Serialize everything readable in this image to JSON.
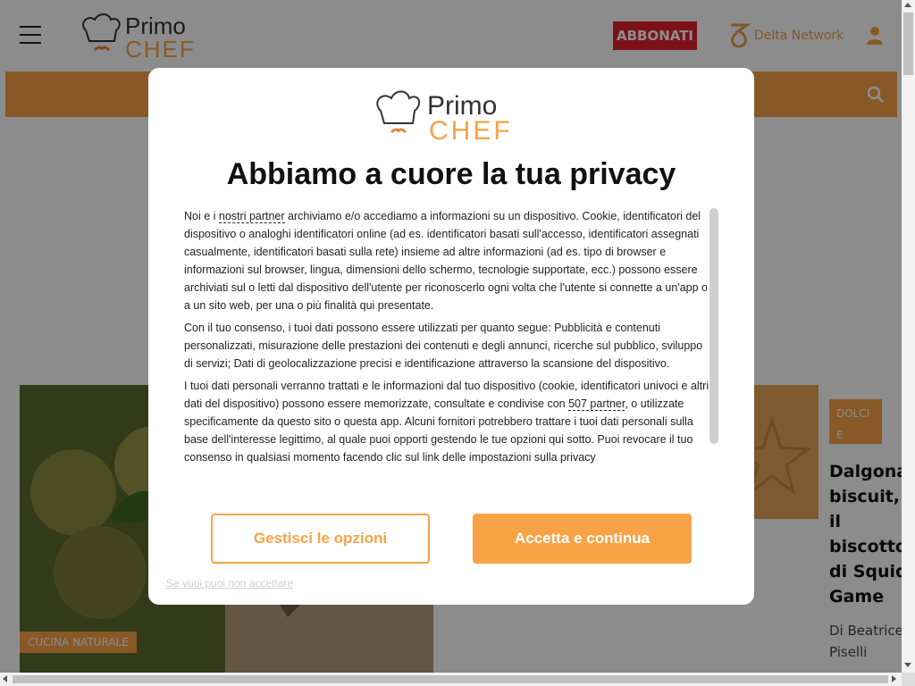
{
  "header": {
    "logo_text_primo": "Primo",
    "logo_text_chef": "CHEF",
    "subscribe_label": "ABBONATI",
    "network_label": "Delta Network"
  },
  "cards": {
    "left_tag": "CUCINA NATURALE",
    "right_tag": "DOLCI E DESSERT",
    "right_title": "Dalgona biscuit, il biscotto di Squid Game",
    "right_author": "Di Beatrice Piselli"
  },
  "modal": {
    "logo_text_primo": "Primo",
    "logo_text_chef": "CHEF",
    "title": "Abbiamo a cuore la tua privacy",
    "p1_before": "Noi e i ",
    "p1_link": "nostri partner",
    "p1_after": " archiviamo e/o accediamo a informazioni su un dispositivo. Cookie, identificatori del dispositivo o analoghi identificatori online (ad es. identificatori basati sull'accesso, identificatori assegnati casualmente, identificatori basati sulla rete) insieme ad altre informazioni (ad es. tipo di browser e informazioni sul browser, lingua, dimensioni dello schermo, tecnologie supportate, ecc.) possono essere archiviati sul o letti dal dispositivo dell'utente per riconoscerlo ogni volta che l'utente si connette a un'app o a un sito web, per una o più finalità qui presentate.",
    "p2": "Con il tuo consenso, i tuoi dati possono essere utilizzati per quanto segue: Pubblicità e contenuti personalizzati, misurazione delle prestazioni dei contenuti e degli annunci, ricerche sul pubblico, sviluppo di servizi; Dati di geolocalizzazione precisi e identificazione attraverso la scansione del dispositivo.",
    "p3_before": "I tuoi dati personali verranno trattati e le informazioni dal tuo dispositivo (cookie, identificatori univoci e altri dati del dispositivo) possono essere memorizzate, consultate e condivise con ",
    "p3_link": "507 partner",
    "p3_after": ", o utilizzate specificamente da questo sito o questa app. Alcuni fornitori potrebbero trattare i tuoi dati personali sulla base dell'interesse legittimo, al quale puoi opporti gestendo le tue opzioni qui sotto. Puoi revocare il tuo consenso in qualsiasi momento facendo clic sul link delle impostazioni sulla privacy",
    "manage_label": "Gestisci le opzioni",
    "accept_label": "Accetta e continua",
    "refuse_label": "Se vuoi puoi non accettare"
  },
  "colors": {
    "brand_orange": "#f7a345",
    "subscribe_red": "#e2222c",
    "title_black": "#111111"
  },
  "icons": [
    "menu-icon",
    "chef-hat-icon",
    "delta-network-icon",
    "user-icon",
    "search-icon"
  ]
}
